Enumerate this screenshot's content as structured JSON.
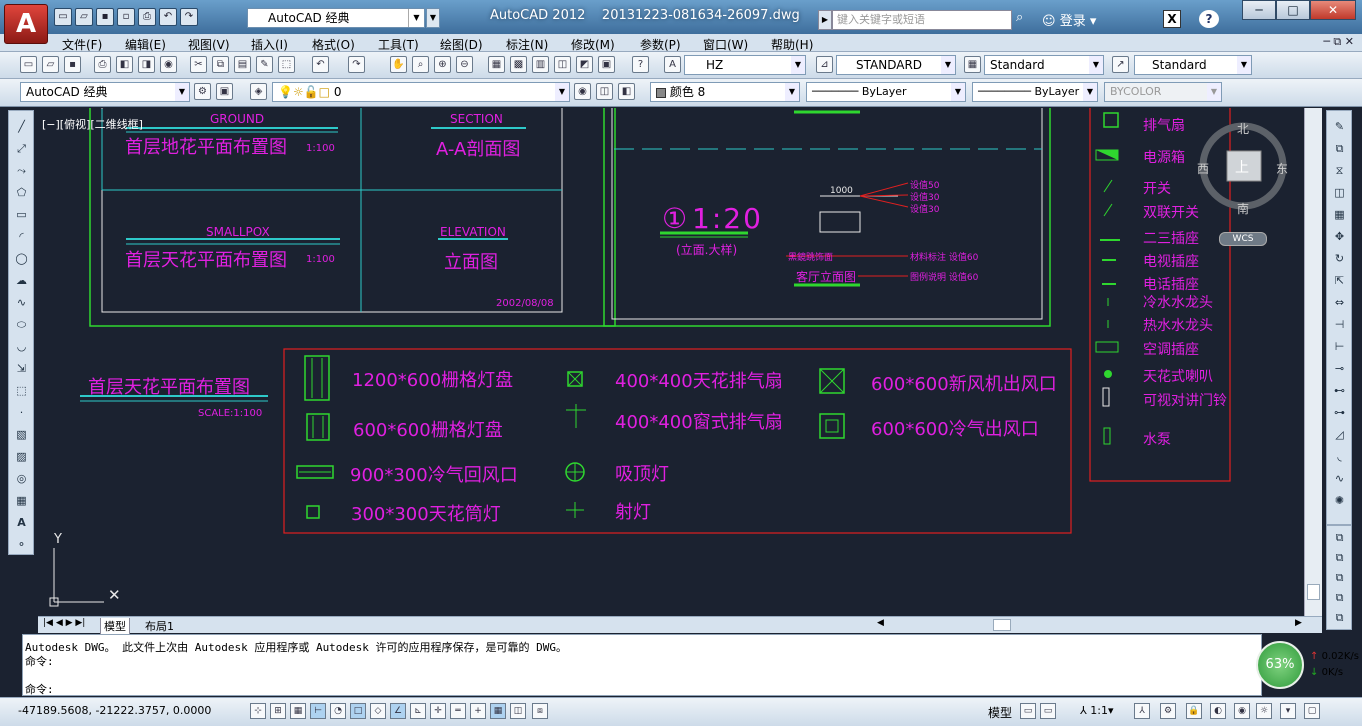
{
  "titlebar": {
    "workspace": "AutoCAD 经典",
    "app_title": "AutoCAD 2012",
    "file_name": "20131223-081634-26097.dwg",
    "search_placeholder": "键入关键字或短语",
    "login": "登录"
  },
  "menu": [
    "文件(F)",
    "编辑(E)",
    "视图(V)",
    "插入(I)",
    "格式(O)",
    "工具(T)",
    "绘图(D)",
    "标注(N)",
    "修改(M)",
    "参数(P)",
    "窗口(W)",
    "帮助(H)"
  ],
  "toolbar": {
    "text_style": "HZ",
    "dim_style": "STANDARD",
    "table_style": "Standard",
    "mleader_style": "Standard",
    "workspace2": "AutoCAD 经典",
    "layer": "0",
    "color": "颜色 8",
    "linetype": "ByLayer",
    "lineweight": "ByLayer",
    "plotstyle": "BYCOLOR"
  },
  "viewport": {
    "label": "[−][俯视][二维线框]"
  },
  "drawing": {
    "panel_tl": {
      "ground": "GROUND",
      "ground_title": "首层地花平面布置图",
      "ground_scale": "1:100",
      "section": "SECTION",
      "section_title": "A-A剖面图",
      "smallpox": "SMALLPOX",
      "smallpox_title": "首层天花平面布置图",
      "smallpox_scale": "1:100",
      "elevation": "ELEVATION",
      "elevation_title": "立面图",
      "date": "2002/08/08"
    },
    "panel_mid": {
      "scale": "1:20",
      "scale_note": "(立面.大样)",
      "dim": "1000",
      "notes": [
        "设值50",
        "设值30",
        "设值30"
      ],
      "label1": "黑鏡跳饰面",
      "label2": "材料标注 设值60",
      "title": "客厅立面图",
      "label3": "图例说明 设值60"
    },
    "legend_title": "首层天花平面布置图",
    "legend_scale": "SCALE:1:100",
    "legend": [
      "1200*600栅格灯盘",
      "600*600栅格灯盘",
      "900*300冷气回风口",
      "300*300天花筒灯",
      "400*400天花排气扇",
      "400*400窗式排气扇",
      "吸顶灯",
      "射灯",
      "600*600新风机出风口",
      "600*600冷气出风口"
    ],
    "rlegend": [
      "排气扇",
      "电源箱",
      "开关",
      "双联开关",
      "二三插座",
      "电视插座",
      "电话插座",
      "冷水水龙头",
      "热水水龙头",
      "空调插座",
      "天花式喇叭",
      "可视对讲门铃",
      "水泵"
    ],
    "viewcube": {
      "north": "北",
      "south": "南",
      "east": "东",
      "west": "西",
      "top": "上",
      "wcs": "WCS"
    }
  },
  "tabs": [
    "模型",
    "布局1"
  ],
  "command": {
    "line1": "Autodesk DWG。  此文件上次由 Autodesk 应用程序或 Autodesk 许可的应用程序保存，是可靠的 DWG。",
    "line2": "命令:",
    "line3": "命令:"
  },
  "status": {
    "coords": "-47189.5608, -21222.3757, 0.0000",
    "model": "模型",
    "anno_scale": "1:1",
    "percent": "63%",
    "up_speed": "0.02K/s",
    "down_speed": "0K/s"
  }
}
